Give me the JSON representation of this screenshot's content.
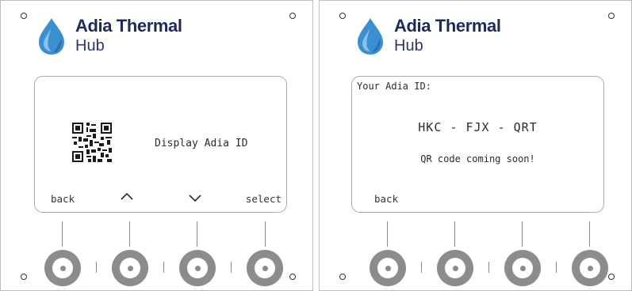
{
  "brand": {
    "line1": "Adia Thermal",
    "line2": "Hub"
  },
  "colors": {
    "accent_blue": "#3a8fd1",
    "light_blue": "#8ac0ea",
    "navy_text": "#1f2a5c",
    "button_gray": "#8c8c8c"
  },
  "left_panel": {
    "screen": {
      "icon": "qr-code-icon",
      "menu_item": "Display Adia ID",
      "softkeys": {
        "back": "back",
        "up": "^",
        "down": "⌄",
        "select": "select"
      }
    }
  },
  "right_panel": {
    "screen": {
      "heading": "Your Adia ID:",
      "id_value": "HKC - FJX - QRT",
      "note": "QR code coming soon!",
      "softkeys": {
        "back": "back"
      }
    }
  }
}
